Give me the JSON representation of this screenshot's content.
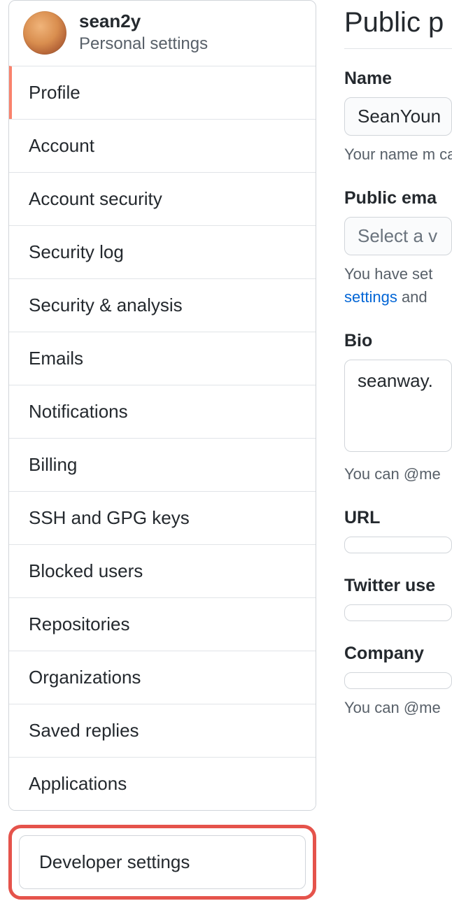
{
  "sidebar": {
    "username": "sean2y",
    "subtitle": "Personal settings",
    "items": [
      {
        "label": "Profile",
        "active": true
      },
      {
        "label": "Account",
        "active": false
      },
      {
        "label": "Account security",
        "active": false
      },
      {
        "label": "Security log",
        "active": false
      },
      {
        "label": "Security & analysis",
        "active": false
      },
      {
        "label": "Emails",
        "active": false
      },
      {
        "label": "Notifications",
        "active": false
      },
      {
        "label": "Billing",
        "active": false
      },
      {
        "label": "SSH and GPG keys",
        "active": false
      },
      {
        "label": "Blocked users",
        "active": false
      },
      {
        "label": "Repositories",
        "active": false
      },
      {
        "label": "Organizations",
        "active": false
      },
      {
        "label": "Saved replies",
        "active": false
      },
      {
        "label": "Applications",
        "active": false
      }
    ],
    "developer_settings": "Developer settings"
  },
  "main": {
    "title": "Public p",
    "name": {
      "label": "Name",
      "value": "SeanYoun",
      "help": "Your name m\ncan remove i"
    },
    "public_email": {
      "label": "Public ema",
      "placeholder": "Select a v",
      "help_pre": "You have set",
      "help_link": "settings",
      "help_post": " and "
    },
    "bio": {
      "label": "Bio",
      "value": "seanway.",
      "help": "You can @me"
    },
    "url": {
      "label": "URL",
      "value": ""
    },
    "twitter": {
      "label": "Twitter use",
      "value": ""
    },
    "company": {
      "label": "Company",
      "value": "",
      "help": "You can @me"
    }
  }
}
